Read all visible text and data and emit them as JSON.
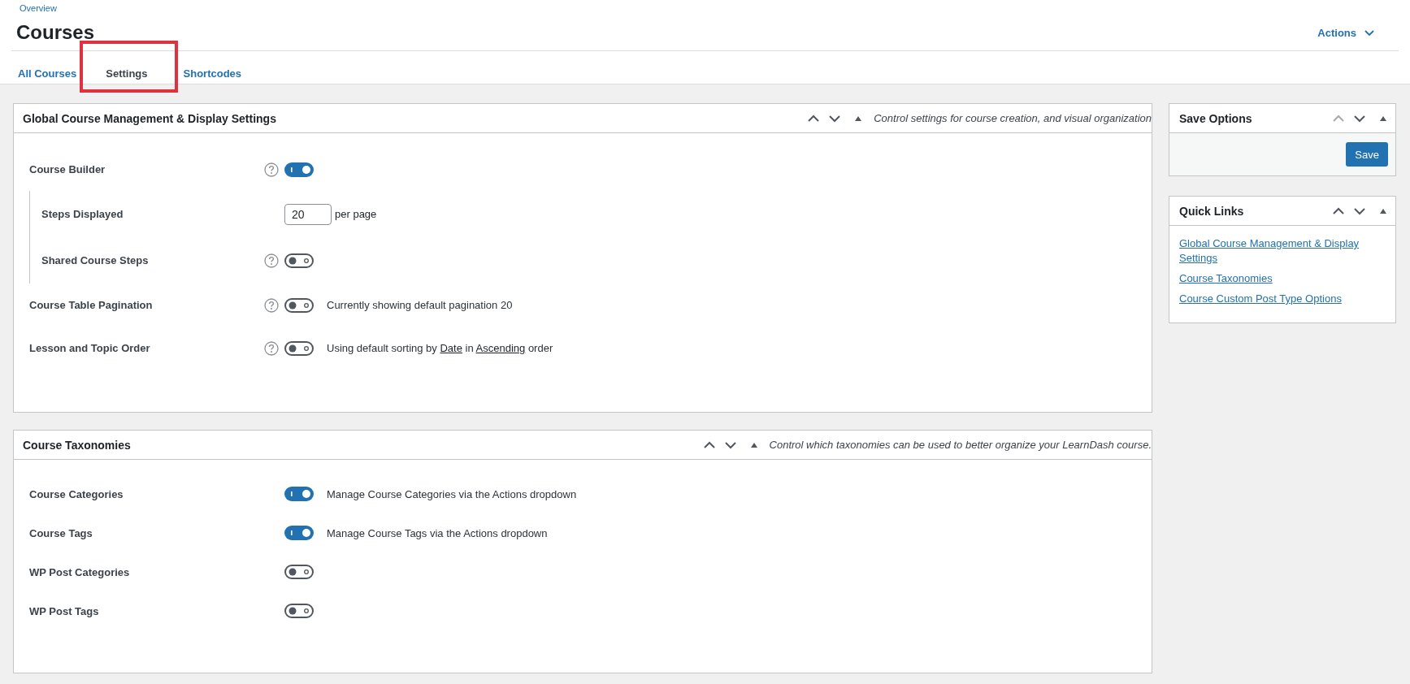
{
  "breadcrumb": "Overview",
  "page_title": "Courses",
  "actions": {
    "label": "Actions"
  },
  "tabs": [
    {
      "label": "All Courses",
      "selected": false
    },
    {
      "label": "Settings",
      "selected": true
    },
    {
      "label": "Shortcodes",
      "selected": false
    }
  ],
  "panels": [
    {
      "title": "Global Course Management & Display Settings",
      "description": "Control settings for course creation, and visual organization",
      "move_up_disabled": false,
      "rows": [
        {
          "label": "Course Builder",
          "help": true,
          "kind": "toggle",
          "on": true,
          "children": [
            {
              "label": "Steps Displayed",
              "help": false,
              "kind": "number",
              "value": "20",
              "suffix": "per page"
            },
            {
              "label": "Shared Course Steps",
              "help": true,
              "kind": "toggle",
              "on": false
            }
          ]
        },
        {
          "label": "Course Table Pagination",
          "help": true,
          "kind": "toggle",
          "on": false,
          "description": [
            {
              "kind": "text",
              "text": "Currently showing default pagination 20"
            }
          ]
        },
        {
          "label": "Lesson and Topic Order",
          "help": true,
          "kind": "toggle",
          "on": false,
          "description": [
            {
              "kind": "text",
              "text": "Using default sorting by "
            },
            {
              "kind": "link",
              "text": "Date"
            },
            {
              "kind": "text",
              "text": " in "
            },
            {
              "kind": "link",
              "text": "Ascending"
            },
            {
              "kind": "text",
              "text": " order"
            }
          ]
        }
      ]
    },
    {
      "title": "Course Taxonomies",
      "description": "Control which taxonomies can be used to better organize your LearnDash course.",
      "move_up_disabled": false,
      "rows": [
        {
          "label": "Course Categories",
          "help": false,
          "kind": "toggle",
          "on": true,
          "description": [
            {
              "kind": "text",
              "text": "Manage Course Categories via the Actions dropdown"
            }
          ]
        },
        {
          "label": "Course Tags",
          "help": false,
          "kind": "toggle",
          "on": true,
          "description": [
            {
              "kind": "text",
              "text": "Manage Course Tags via the Actions dropdown"
            }
          ]
        },
        {
          "label": "WP Post Categories",
          "help": false,
          "kind": "toggle",
          "on": false
        },
        {
          "label": "WP Post Tags",
          "help": false,
          "kind": "toggle",
          "on": false
        }
      ]
    }
  ],
  "save_box": {
    "title": "Save Options",
    "move_up_disabled": true,
    "button": "Save"
  },
  "quick_links": {
    "title": "Quick Links",
    "move_up_disabled": false,
    "links": [
      "Global Course Management & Display Settings",
      "Course Taxonomies",
      "Course Custom Post Type Options"
    ]
  }
}
